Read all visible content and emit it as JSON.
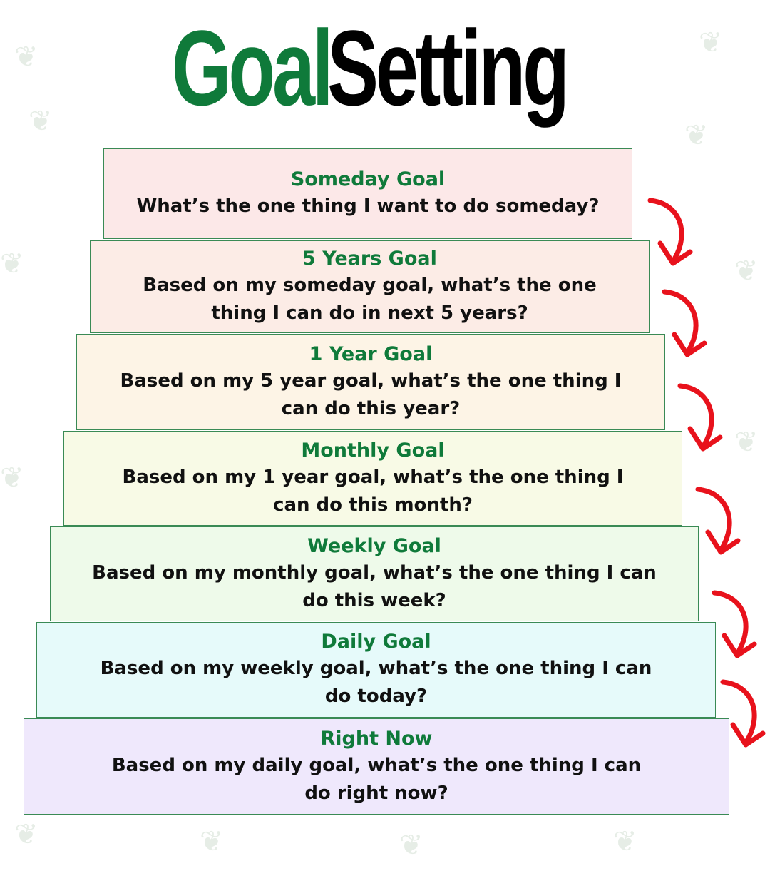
{
  "title": {
    "word1": "Goal",
    "word2": "Setting",
    "color1": "#0f7a3a",
    "color2": "#000000"
  },
  "steps": [
    {
      "title": "Someday Goal",
      "text": "What’s the one thing I want to do someday?",
      "bg": "#fce8e8"
    },
    {
      "title": "5 Years Goal",
      "text": "Based on my someday goal, what’s the one\nthing I can do in next 5 years?",
      "bg": "#fcece6"
    },
    {
      "title": "1 Year Goal",
      "text": "Based on my 5 year goal, what’s the one thing I\ncan do this year?",
      "bg": "#fdf4e6"
    },
    {
      "title": "Monthly Goal",
      "text": "Based on my 1 year goal, what’s the one thing I\ncan do this month?",
      "bg": "#f8fae6"
    },
    {
      "title": "Weekly Goal",
      "text": "Based on my monthly goal, what’s the one thing I can\ndo this week?",
      "bg": "#eefaea"
    },
    {
      "title": "Daily Goal",
      "text": "Based on my weekly goal, what’s the one thing I can\ndo today?",
      "bg": "#e6fafa"
    },
    {
      "title": "Right Now",
      "text": "Based on my daily goal, what’s the one thing I can\ndo right now?",
      "bg": "#efe8fc"
    }
  ],
  "arrow_color": "#e8121c",
  "arrow_icon": "curved-down-arrow-icon"
}
